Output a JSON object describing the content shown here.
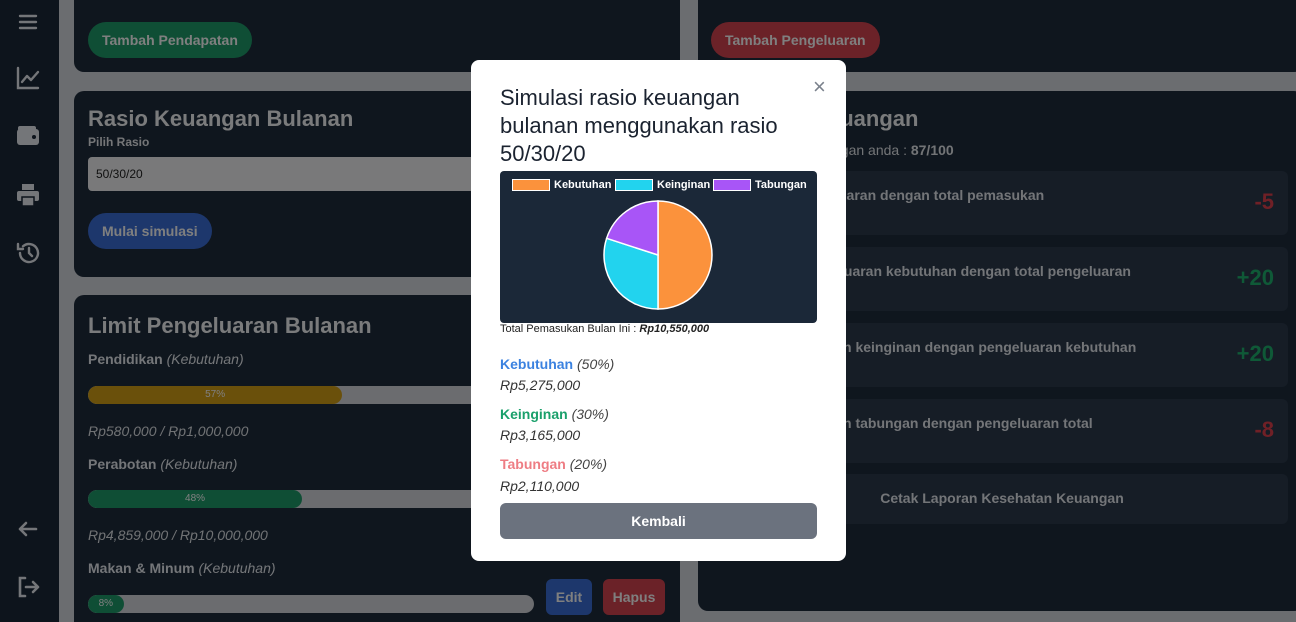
{
  "income_card": {
    "add_income_label": "Tambah Pendapatan"
  },
  "expense_card": {
    "add_expense_label": "Tambah Pengeluaran"
  },
  "ratio_card": {
    "title": "Rasio Keuangan Bulanan",
    "select_label": "Pilih Rasio",
    "selected_ratio": "50/30/20",
    "start_button": "Mulai simulasi"
  },
  "limit_card": {
    "title": "Limit Pengeluaran Bulanan",
    "items": [
      {
        "name": "Pendidikan",
        "type": "(Kebutuhan)",
        "percent_label": "57%",
        "percent": 0.57,
        "amount": "Rp580,000 / Rp1,000,000",
        "color": "#d4a017"
      },
      {
        "name": "Perabotan",
        "type": "(Kebutuhan)",
        "percent_label": "48%",
        "percent": 0.48,
        "amount": "Rp4,859,000 / Rp10,000,000",
        "color": "#1f9d6b"
      },
      {
        "name": "Makan & Minum",
        "type": "(Kebutuhan)",
        "percent_label": "8%",
        "percent": 0.08,
        "amount": "",
        "color": "#1f9d6b"
      }
    ],
    "edit_label": "Edit",
    "delete_label": "Hapus"
  },
  "health_card": {
    "title_partial": "euangan",
    "score_prefix": "ngan anda : ",
    "score_value": "87/100",
    "rows": [
      {
        "text": "uaran dengan total pemasukan",
        "score": "-5",
        "kind": "neg"
      },
      {
        "text": "luaran kebutuhan dengan total pengeluaran",
        "score": "+20",
        "kind": "pos"
      },
      {
        "text": "n keinginan dengan pengeluaran kebutuhan",
        "score": "+20",
        "kind": "pos"
      },
      {
        "text": "n tabungan dengan pengeluaran total",
        "score": "-8",
        "kind": "neg"
      }
    ],
    "print_label": "Cetak Laporan Kesehatan Keuangan"
  },
  "modal": {
    "title": "Simulasi rasio keuangan bulanan menggunakan rasio 50/30/20",
    "close_glyph": "×",
    "total_prefix": "Total Pemasukan Bulan Ini : ",
    "total_value": "Rp10,550,000",
    "allocations": [
      {
        "name": "Kebutuhan",
        "pct": "(50%)",
        "value": "Rp5,275,000",
        "color": "#3b82e0"
      },
      {
        "name": "Keinginan",
        "pct": "(30%)",
        "value": "Rp3,165,000",
        "color": "#1aa06b"
      },
      {
        "name": "Tabungan",
        "pct": "(20%)",
        "value": "Rp2,110,000",
        "color": "#ee7d84"
      }
    ],
    "back_label": "Kembali"
  },
  "chart_data": {
    "type": "pie",
    "categories": [
      "Kebutuhan",
      "Keinginan",
      "Tabungan"
    ],
    "values": [
      50,
      30,
      20
    ],
    "colors": [
      "#fb923c",
      "#22d3ee",
      "#a855f7"
    ],
    "legend": "top"
  },
  "sidebar": {
    "icons": [
      "menu-icon",
      "chart-line-icon",
      "wallet-icon",
      "printer-icon",
      "history-icon",
      "arrow-left-icon",
      "logout-icon"
    ]
  }
}
